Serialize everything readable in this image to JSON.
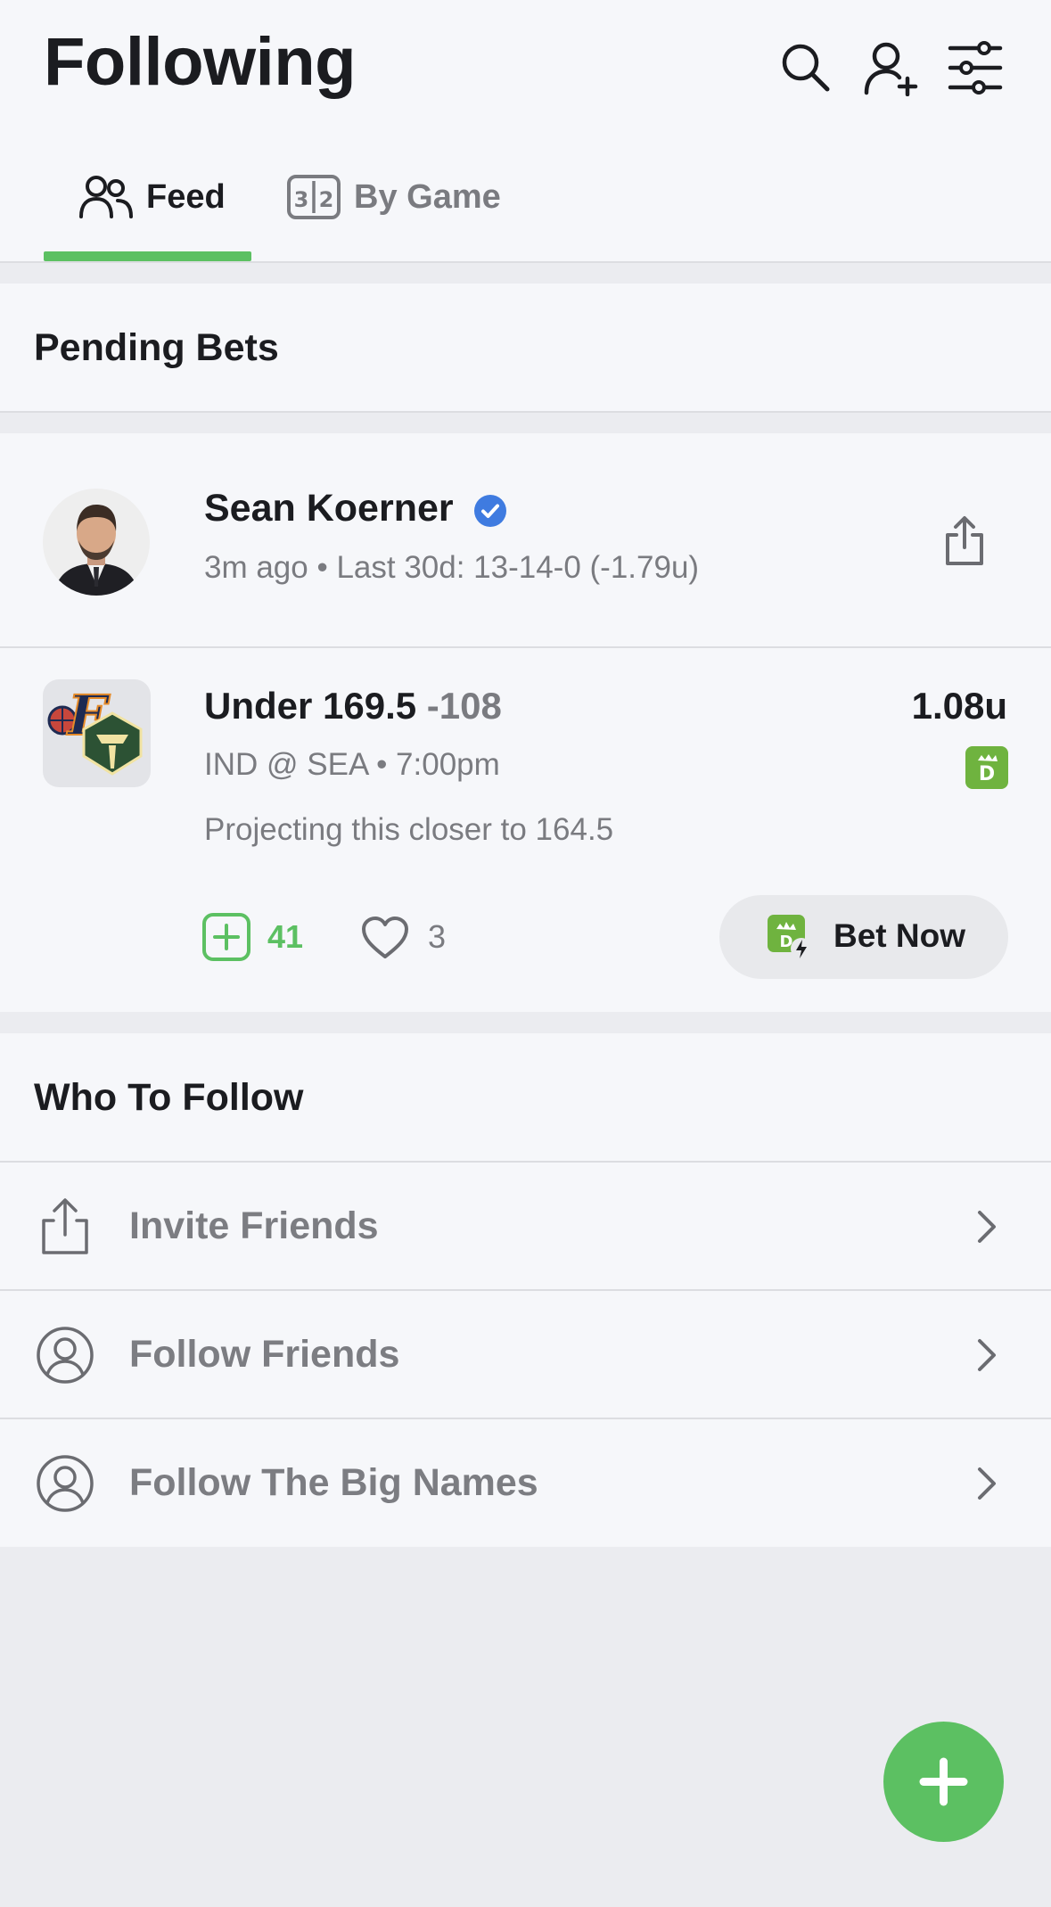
{
  "header": {
    "title": "Following",
    "tabs": [
      {
        "label": "Feed",
        "active": true
      },
      {
        "label": "By Game",
        "active": false
      }
    ]
  },
  "pending": {
    "section_title": "Pending Bets",
    "post": {
      "author": "Sean Koerner",
      "verified": true,
      "meta": "3m ago • Last 30d: 13-14-0 (-1.79u)",
      "bet_label": "Under 169.5",
      "odds": "-108",
      "units": "1.08u",
      "game": "IND @ SEA • 7:00pm",
      "note": "Projecting this closer to 164.5",
      "tail_count": "41",
      "like_count": "3",
      "bet_button": "Bet Now"
    }
  },
  "who_to_follow": {
    "section_title": "Who To Follow",
    "items": [
      {
        "label": "Invite Friends",
        "icon": "share-icon"
      },
      {
        "label": "Follow Friends",
        "icon": "user-circle-icon"
      },
      {
        "label": "Follow The Big Names",
        "icon": "user-circle-icon"
      }
    ]
  },
  "colors": {
    "accent": "#5cc062",
    "verified": "#3f7be0",
    "muted_text": "#7a7b80",
    "background": "#f6f7fa"
  }
}
